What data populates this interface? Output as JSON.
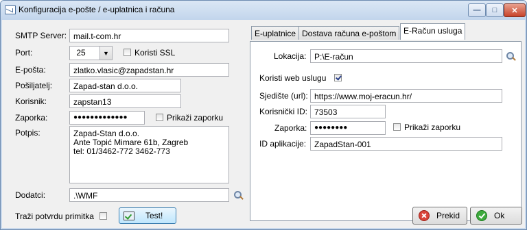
{
  "window": {
    "title": "Konfiguracija e-pošte / e-uplatnica i računa",
    "controls": {
      "minimize": "—",
      "maximize": "□",
      "close": "✕"
    }
  },
  "left": {
    "smtp_label": "SMTP Server:",
    "smtp_value": "mail.t-com.hr",
    "port_label": "Port:",
    "port_value": "25",
    "ssl_label": "Koristi SSL",
    "ssl_checked": false,
    "email_label": "E-pošta:",
    "email_value": "zlatko.vlasic@zapadstan.hr",
    "sender_label": "Pošiljatelj:",
    "sender_value": "Zapad-stan d.o.o.",
    "user_label": "Korisnik:",
    "user_value": "zapstan13",
    "password_label": "Zaporka:",
    "password_value": "●●●●●●●●●●●●●",
    "show_password_label": "Prikaži zaporku",
    "show_password_checked": false,
    "signature_label": "Potpis:",
    "signature_value": "Zapad-Stan d.o.o.\nAnte Topić Mimare 61b, Zagreb\ntel: 01/3462-772 3462-773",
    "attachments_label": "Dodatci:",
    "attachments_value": ".\\WMF"
  },
  "tabs": [
    {
      "label": "E-uplatnice",
      "active": false
    },
    {
      "label": "Dostava računa e-poštom",
      "active": false
    },
    {
      "label": "E-Račun usluga",
      "active": true
    }
  ],
  "eracun": {
    "location_label": "Lokacija:",
    "location_value": "P:\\E-račun",
    "webservice_label": "Koristi web uslugu",
    "webservice_checked": true,
    "url_label": "Sjedište (url):",
    "url_value": "https://www.moj-eracun.hr/",
    "userid_label": "Korisnički ID:",
    "userid_value": "73503",
    "password_label": "Zaporka:",
    "password_value": "●●●●●●●●",
    "show_password_label": "Prikaži zaporku",
    "show_password_checked": false,
    "appid_label": "ID aplikacije:",
    "appid_value": "ZapadStan-001"
  },
  "footer": {
    "receipt_label": "Traži potvrdu primitka",
    "receipt_checked": false,
    "test_label": "Test!",
    "cancel_label": "Prekid",
    "ok_label": "Ok"
  }
}
